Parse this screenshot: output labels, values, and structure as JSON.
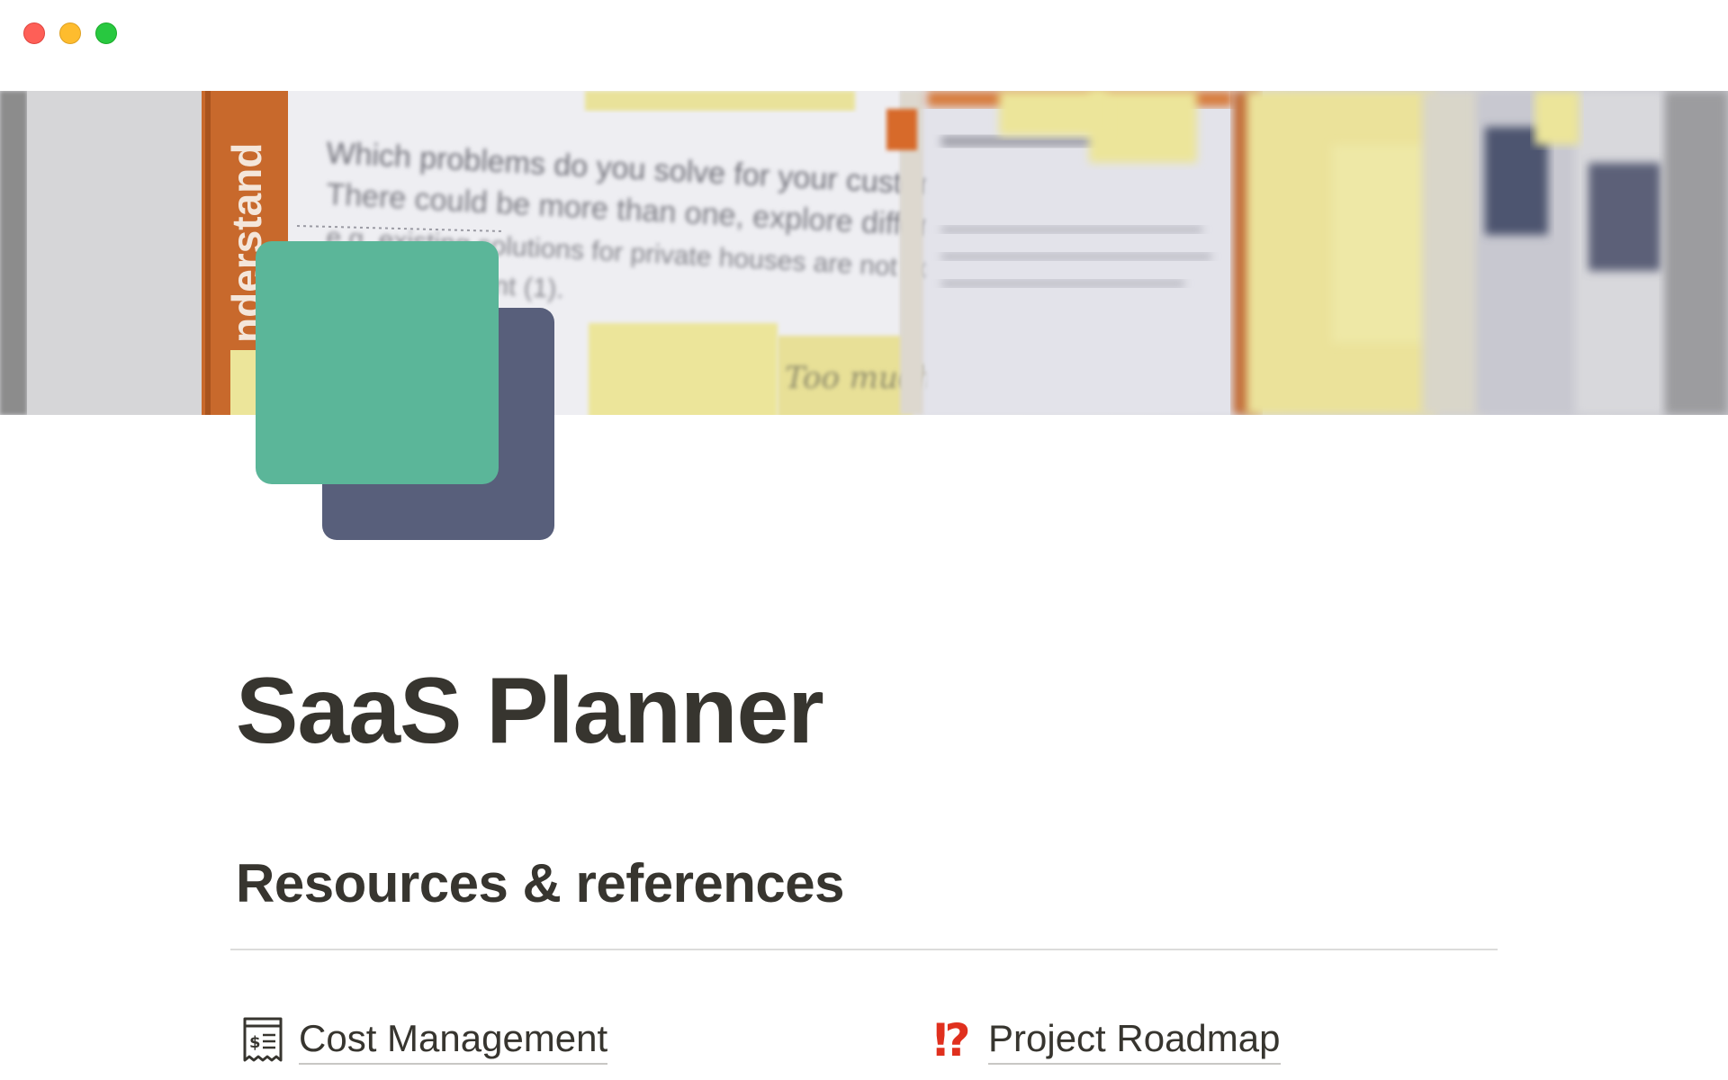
{
  "window": {
    "controls": [
      "close",
      "minimize",
      "maximize"
    ]
  },
  "cover": {
    "description_icon": "cover-photo",
    "text_fragments": {
      "vertical_tab": "nderstand",
      "line1": "Which problems do you solve for your customer?",
      "line2": "There could be more than one, explore different sides.",
      "line3": "e.g. existing solutions for private houses are not considered",
      "line4": "nt (1).",
      "note": "Too much"
    }
  },
  "page": {
    "icon": "layered-squares-icon",
    "title": "SaaS Planner"
  },
  "sections": [
    {
      "heading": "Resources & references",
      "links": [
        {
          "label": "Cost Management",
          "icon": "receipt-icon"
        },
        {
          "label": "Project Roadmap",
          "icon": "exclamation-question-icon",
          "glyph": "⁉"
        }
      ]
    }
  ],
  "colors": {
    "icon_front": "#5bb699",
    "icon_back": "#585f7b",
    "text": "#37352f",
    "accent_red": "#e0301e"
  }
}
